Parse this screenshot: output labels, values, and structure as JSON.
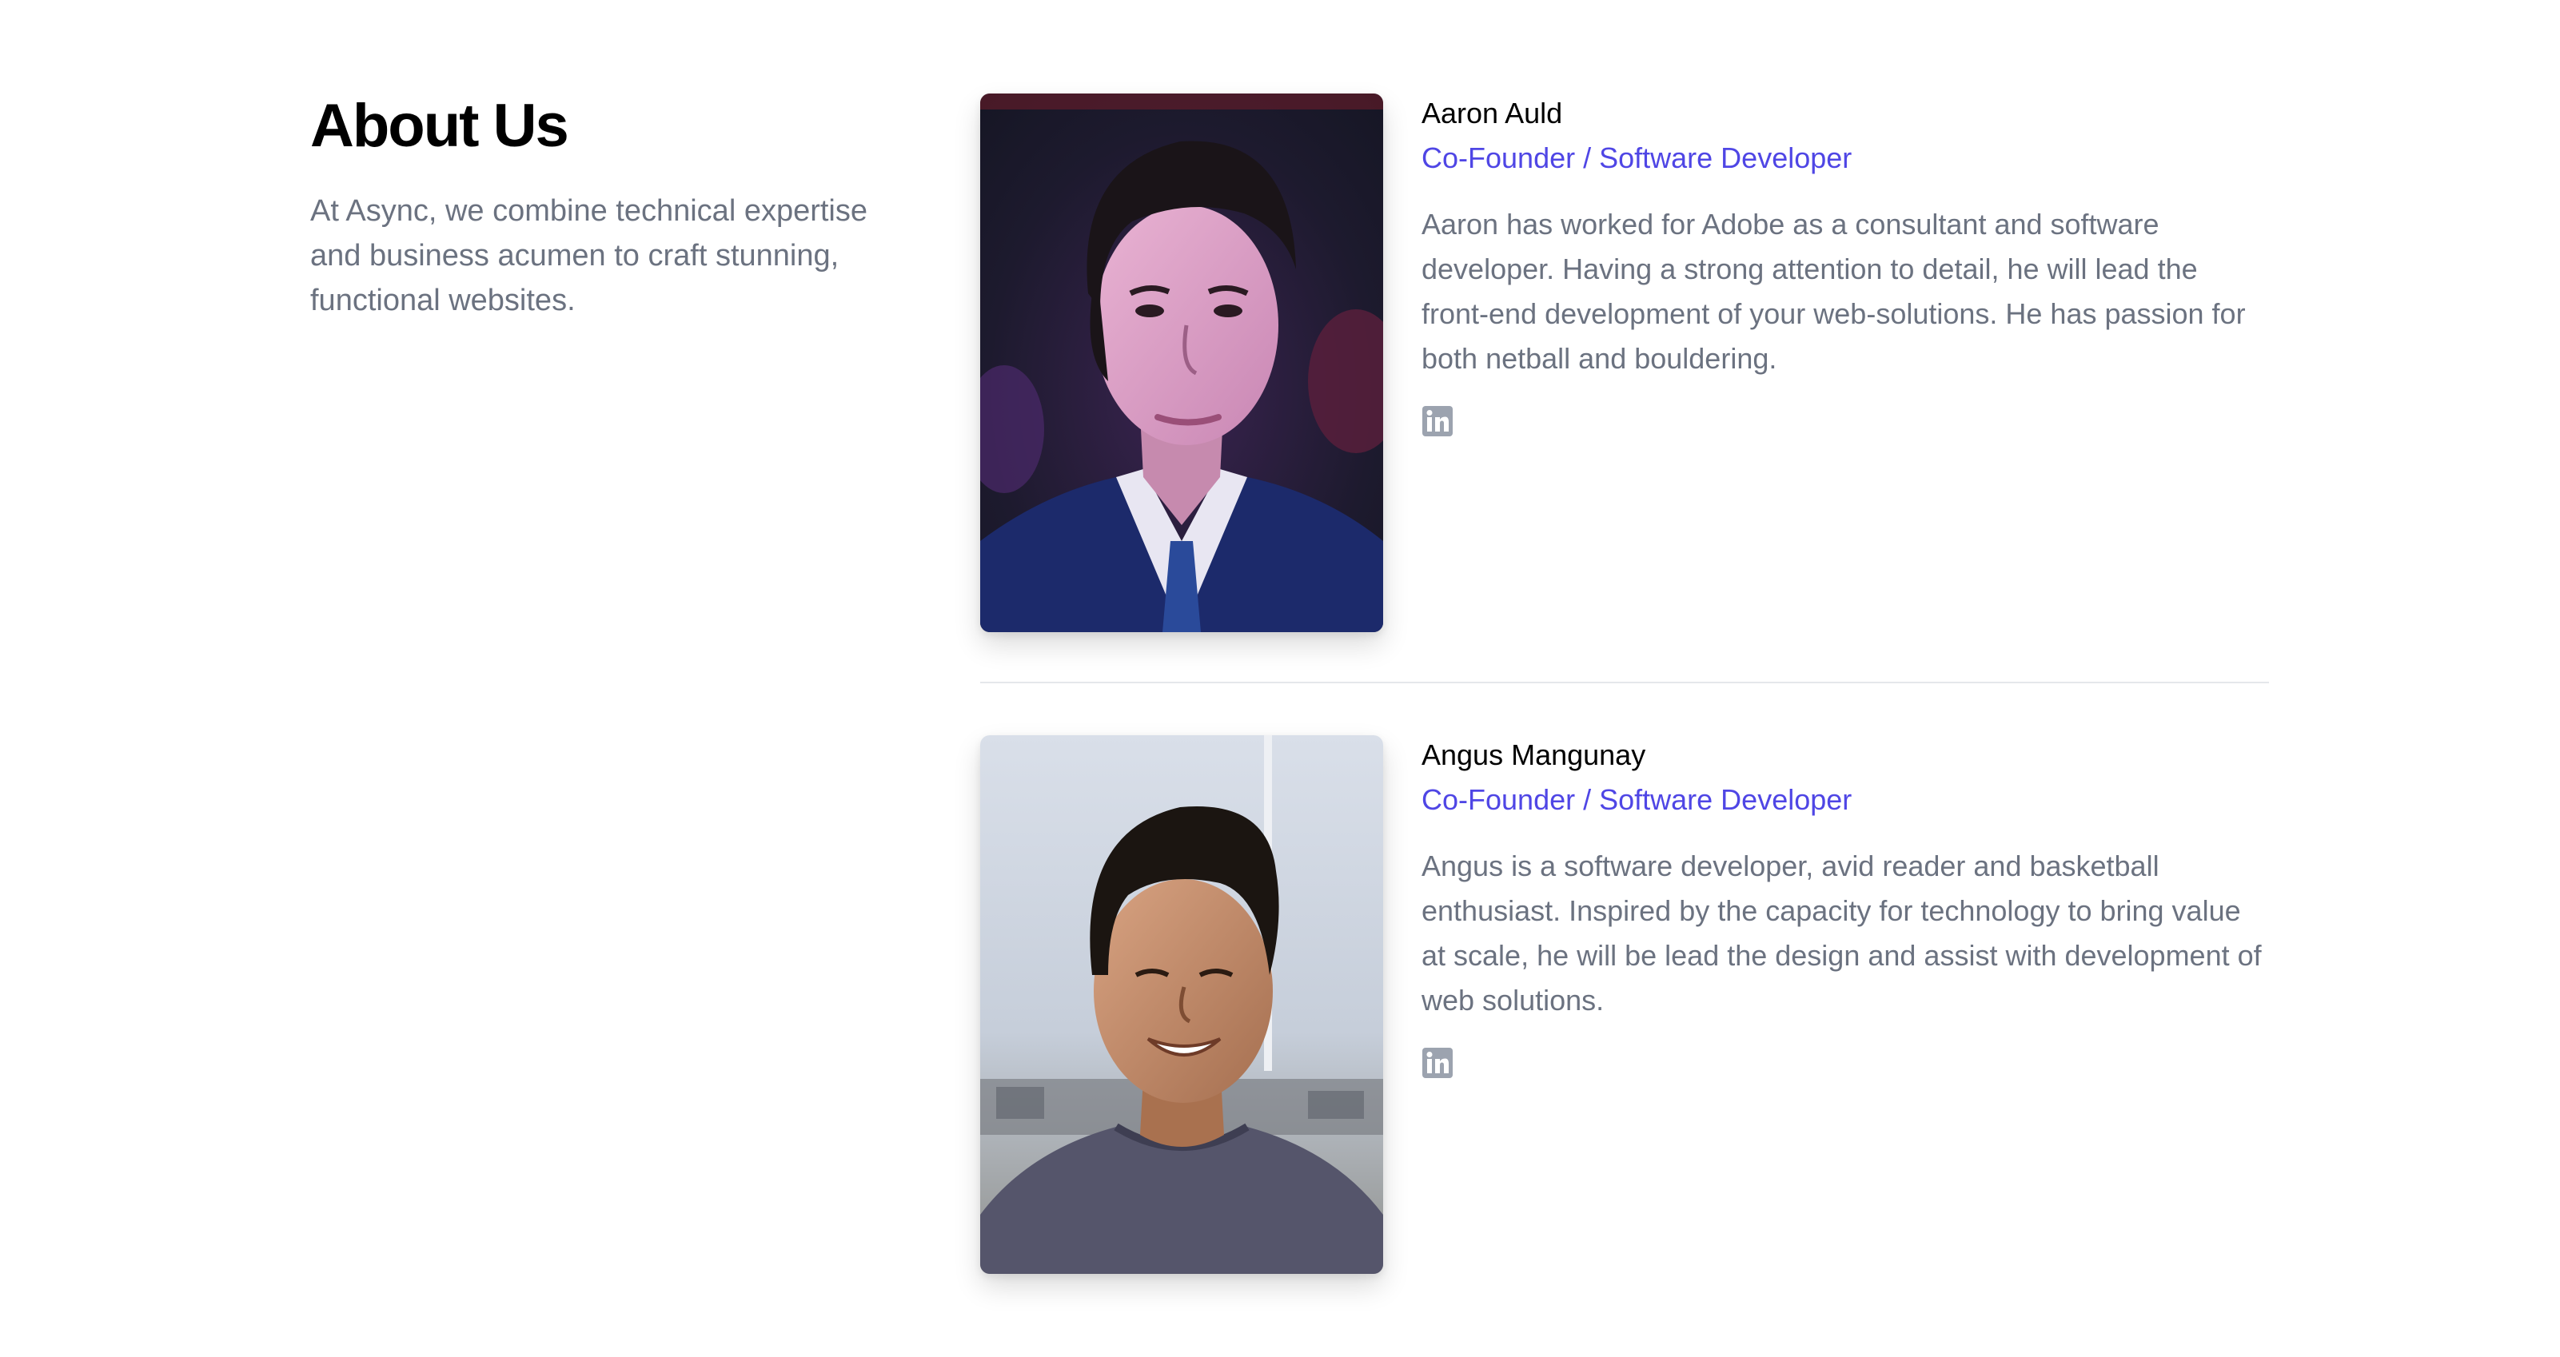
{
  "intro": {
    "title": "About Us",
    "description": "At Async, we combine technical expertise and business acumen to craft stunning, functional websites."
  },
  "members": [
    {
      "name": "Aaron Auld",
      "role": "Co-Founder / Software Developer",
      "bio": "Aaron has worked for Adobe as a consultant and software developer. Having a strong attention to detail, he will lead the front-end development of your web-solutions. He has passion for both netball and bouldering.",
      "social_icon": "linkedin-icon"
    },
    {
      "name": "Angus Mangunay",
      "role": "Co-Founder / Software Developer",
      "bio": "Angus is a software developer, avid reader and basketball enthusiast. Inspired by the capacity for technology to bring value at scale, he will be lead the design and assist with development of web solutions.",
      "social_icon": "linkedin-icon"
    }
  ],
  "colors": {
    "accent": "#4f46e5",
    "muted_text": "#6b7280",
    "heading": "#000000",
    "divider": "#e5e7eb",
    "icon": "#9ca3af"
  }
}
